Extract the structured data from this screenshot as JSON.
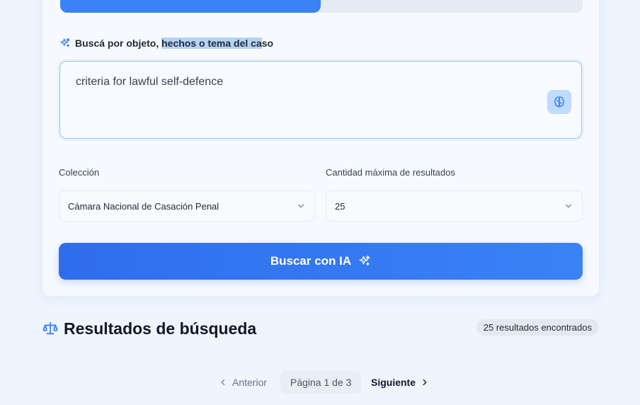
{
  "form": {
    "query_label_pre": "Buscá por objeto, ",
    "query_label_sel": "hechos o tema del ca",
    "query_label_post": "so",
    "query_value": "criteria for lawful self-defence",
    "collection_label": "Colección",
    "collection_value": "Cámara Nacional de Casación Penal",
    "max_results_label": "Cantidad máxima de resultados",
    "max_results_value": "25",
    "search_button_label": "Buscar con IA"
  },
  "results": {
    "title": "Resultados de búsqueda",
    "count_label": "25 resultados encontrados"
  },
  "pagination": {
    "prev_label": "Anterior",
    "page_info": "Página 1 de 3",
    "next_label": "Siguiente"
  },
  "colors": {
    "accent": "#3b82f6",
    "background": "#eff5fe"
  }
}
